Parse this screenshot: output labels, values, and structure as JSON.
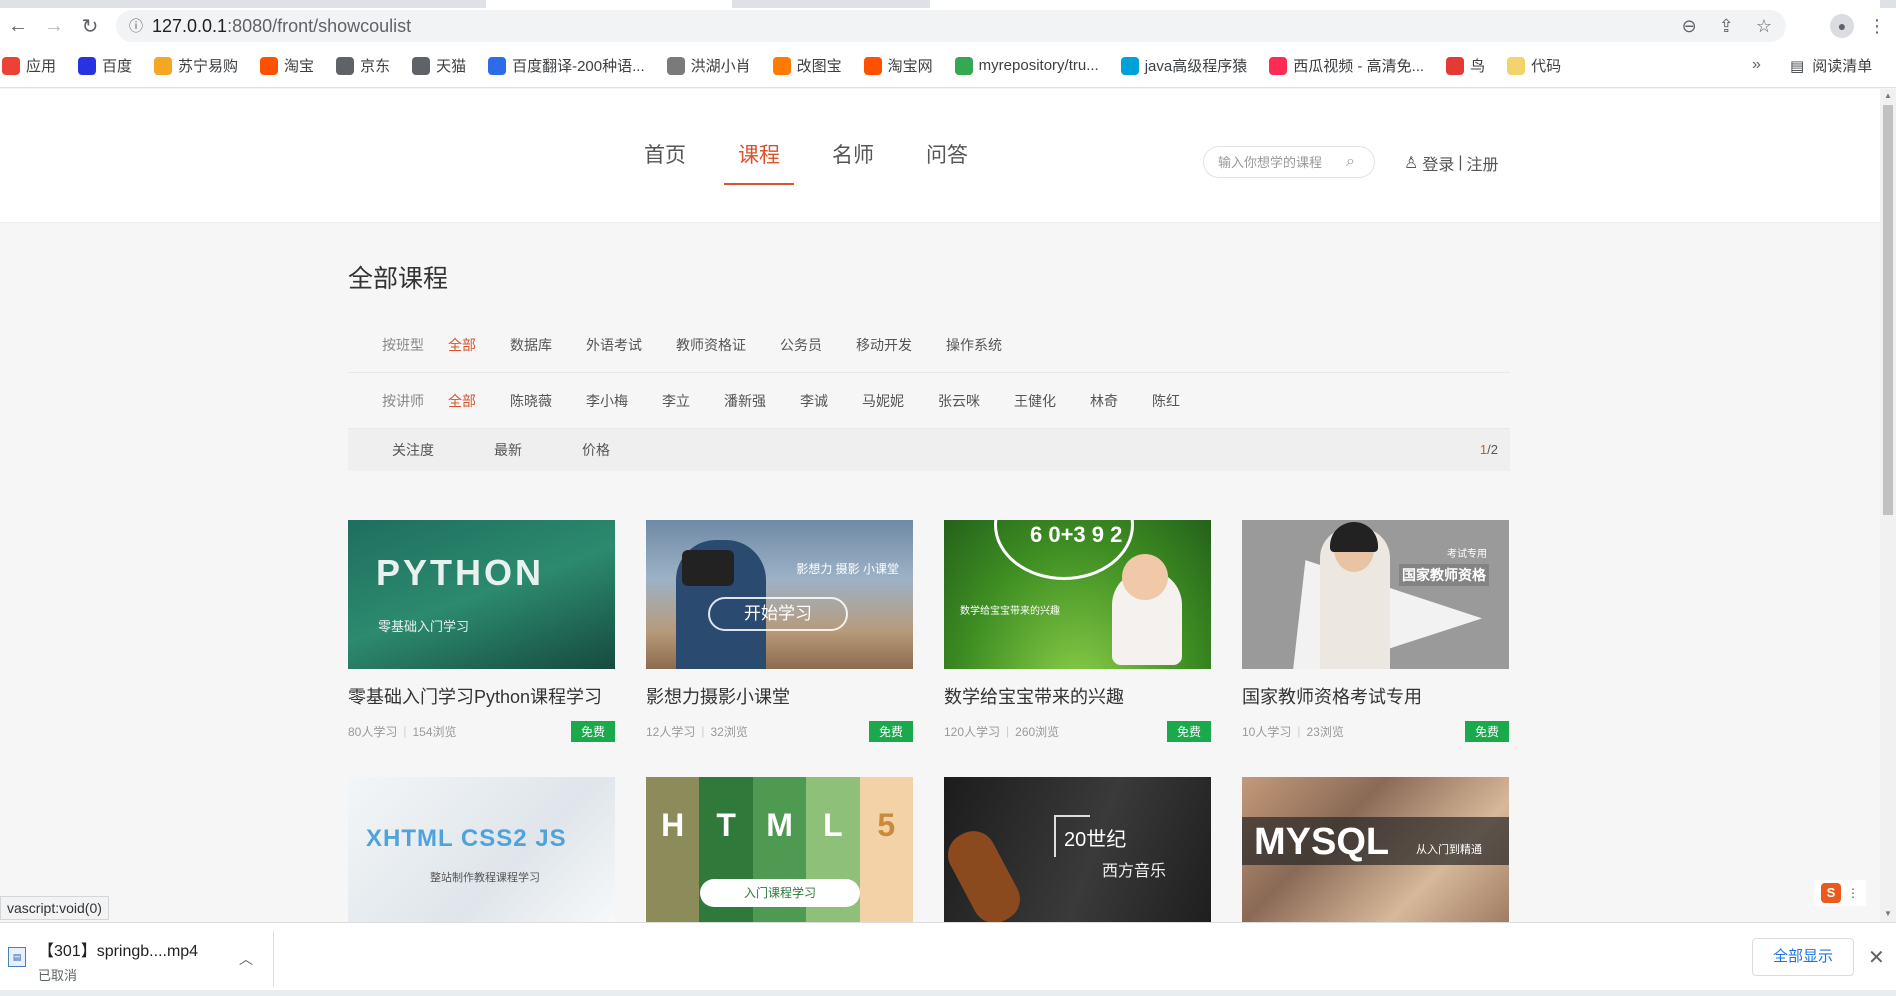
{
  "browser": {
    "url_host": "127.0.0.1",
    "url_rest": ":8080/front/showcoulist",
    "bookmarks": [
      {
        "label": "应用",
        "icon": "apps-grid-icon",
        "color": "#ea4335"
      },
      {
        "label": "百度",
        "icon": "baidu-icon",
        "color": "#2932e1"
      },
      {
        "label": "苏宁易购",
        "icon": "suning-icon",
        "color": "#f5a623"
      },
      {
        "label": "淘宝",
        "icon": "taobao-icon",
        "color": "#ff5000"
      },
      {
        "label": "京东",
        "icon": "globe-icon",
        "color": "#5f6368"
      },
      {
        "label": "天猫",
        "icon": "globe-icon",
        "color": "#5f6368"
      },
      {
        "label": "百度翻译-200种语...",
        "icon": "translate-icon",
        "color": "#2e6be6"
      },
      {
        "label": "洪湖小肖",
        "icon": "bird-icon",
        "color": "#7a7a7a"
      },
      {
        "label": "改图宝",
        "icon": "gaitubao-icon",
        "color": "#ff7a00"
      },
      {
        "label": "淘宝网",
        "icon": "taobao-icon",
        "color": "#ff5000"
      },
      {
        "label": "myrepository/tru...",
        "icon": "chrome-icon",
        "color": "#34a853"
      },
      {
        "label": "java高级程序猿",
        "icon": "bilibili-icon",
        "color": "#00a1d6"
      },
      {
        "label": "西瓜视频 - 高清免...",
        "icon": "xigua-icon",
        "color": "#fe2c55"
      },
      {
        "label": "鸟",
        "icon": "bird-red-icon",
        "color": "#e53935"
      },
      {
        "label": "代码",
        "icon": "folder-icon",
        "color": "#f3d36b"
      }
    ],
    "more": "»",
    "reading_list": "阅读清单"
  },
  "site": {
    "nav": [
      {
        "label": "首页",
        "active": false
      },
      {
        "label": "课程",
        "active": true
      },
      {
        "label": "名师",
        "active": false
      },
      {
        "label": "问答",
        "active": false
      }
    ],
    "search_placeholder": "输入你想学的课程",
    "login": "登录",
    "sep": "|",
    "register": "注册",
    "accent_color": "#d9532c"
  },
  "main": {
    "title": "全部课程",
    "filter_type": {
      "label": "按班型",
      "items": [
        "全部",
        "数据库",
        "外语考试",
        "教师资格证",
        "公务员",
        "移动开发",
        "操作系统"
      ]
    },
    "filter_teacher": {
      "label": "按讲师",
      "items": [
        "全部",
        "陈晓薇",
        "李小梅",
        "李立",
        "潘新强",
        "李诚",
        "马妮妮",
        "张云咪",
        "王健化",
        "林奇",
        "陈红"
      ]
    },
    "sort": [
      "关注度",
      "最新",
      "价格"
    ],
    "page_current": "1",
    "page_total": "/2",
    "courses": [
      {
        "title": "零基础入门学习Python课程学习",
        "learners": "80人学习",
        "views": "154浏览",
        "price": "免费",
        "thumb_big": "PYTHON",
        "thumb_sub": "零基础入门学习"
      },
      {
        "title": "影想力摄影小课堂",
        "learners": "12人学习",
        "views": "32浏览",
        "price": "免费",
        "thumb_tag": "影想力  摄影  小课堂",
        "thumb_start": "开始学习"
      },
      {
        "title": "数学给宝宝带来的兴趣",
        "learners": "120人学习",
        "views": "260浏览",
        "price": "免费",
        "thumb_nums": "6 0+3 9\n 2",
        "thumb_cap": "数学给宝宝带来的兴趣"
      },
      {
        "title": "国家教师资格考试专用",
        "learners": "10人学习",
        "views": "23浏览",
        "price": "免费",
        "thumb_k1": "考试专用",
        "thumb_k2": "国家教师资格"
      },
      {
        "thumb_big": "XHTML  CSS2  JS",
        "thumb_sub": "整站制作教程课程学习"
      },
      {
        "thumb_letters": [
          "H",
          "T",
          "M",
          "L",
          "5"
        ],
        "thumb_pill": "入门课程学习",
        "thumb_colors": [
          "#8c8c5a",
          "#2f7a3a",
          "#4f9a52",
          "#8ec07a",
          "#f3d2a8"
        ]
      },
      {
        "thumb_t1": "20世纪",
        "thumb_t2": "西方音乐"
      },
      {
        "thumb_big": "MYSQL",
        "thumb_sub": "从入门到精通"
      }
    ]
  },
  "statusbar": "vascript:void(0)",
  "download": {
    "filename": "【301】springb....mp4",
    "state": "已取消",
    "show_all": "全部显示"
  }
}
